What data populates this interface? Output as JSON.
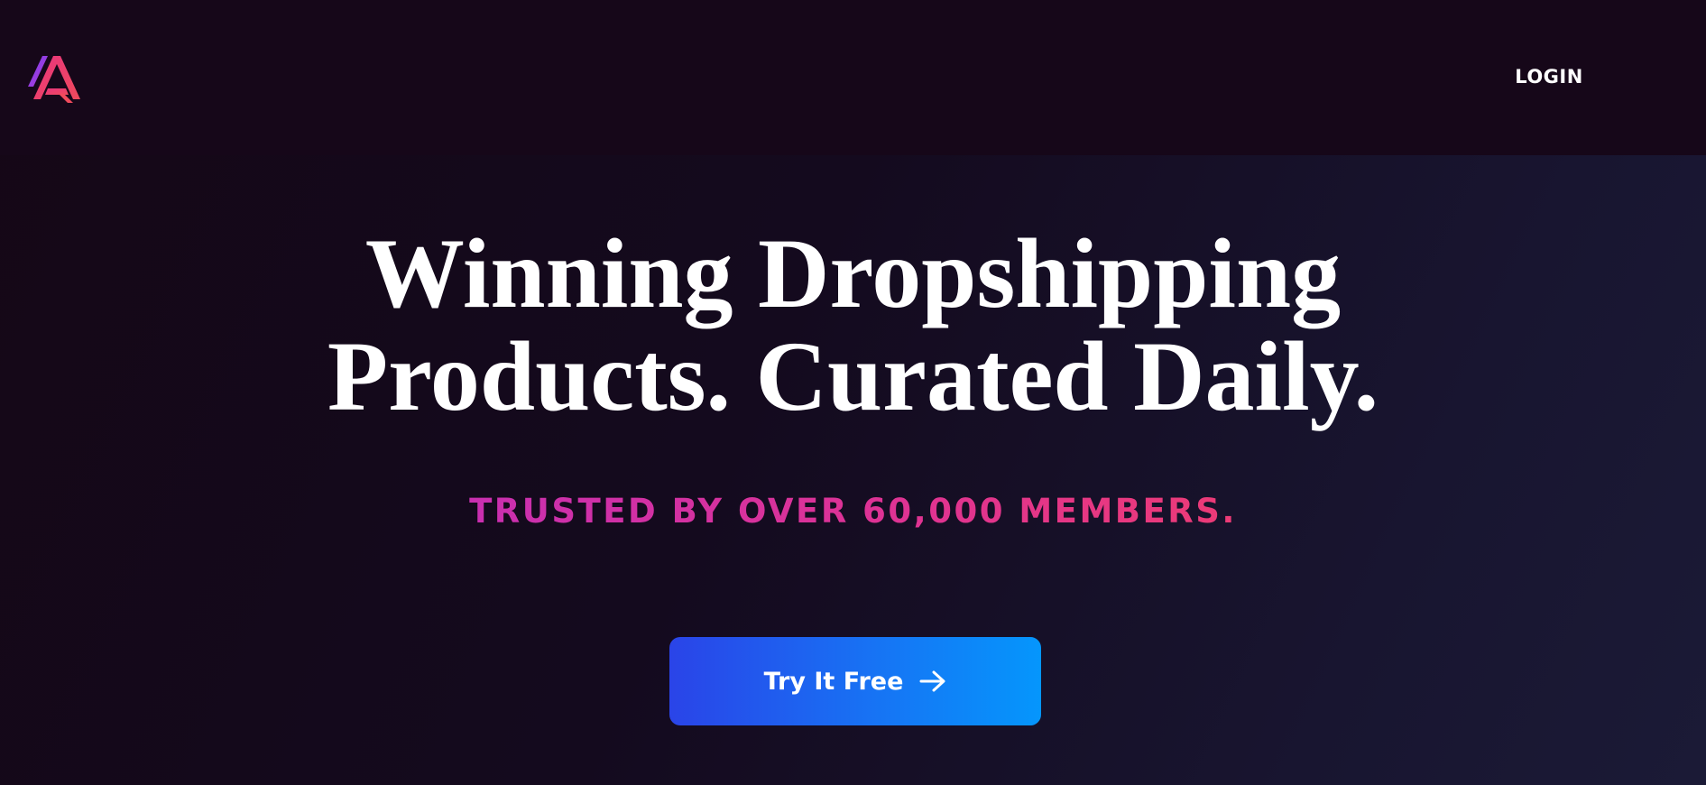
{
  "brand": {
    "logo_icon": "brand-a-logo-icon",
    "colors": {
      "logo_purple": "#7b3ff2",
      "logo_pink": "#f0356f"
    }
  },
  "header": {
    "login_label": "LOGIN"
  },
  "hero": {
    "title_line1": "Winning Dropshipping",
    "title_line2": "Products. Curated Daily.",
    "tagline": "TRUSTED BY OVER 60,000 MEMBERS.",
    "cta_label": "Try It Free",
    "cta_icon": "arrow-right-icon"
  },
  "colors": {
    "background": "#150716",
    "header_background": "#160719",
    "title_text": "#ffffff",
    "tagline_accent": "#d72e9b",
    "cta_gradient_start": "#2a44e8",
    "cta_gradient_end": "#0596fc"
  }
}
